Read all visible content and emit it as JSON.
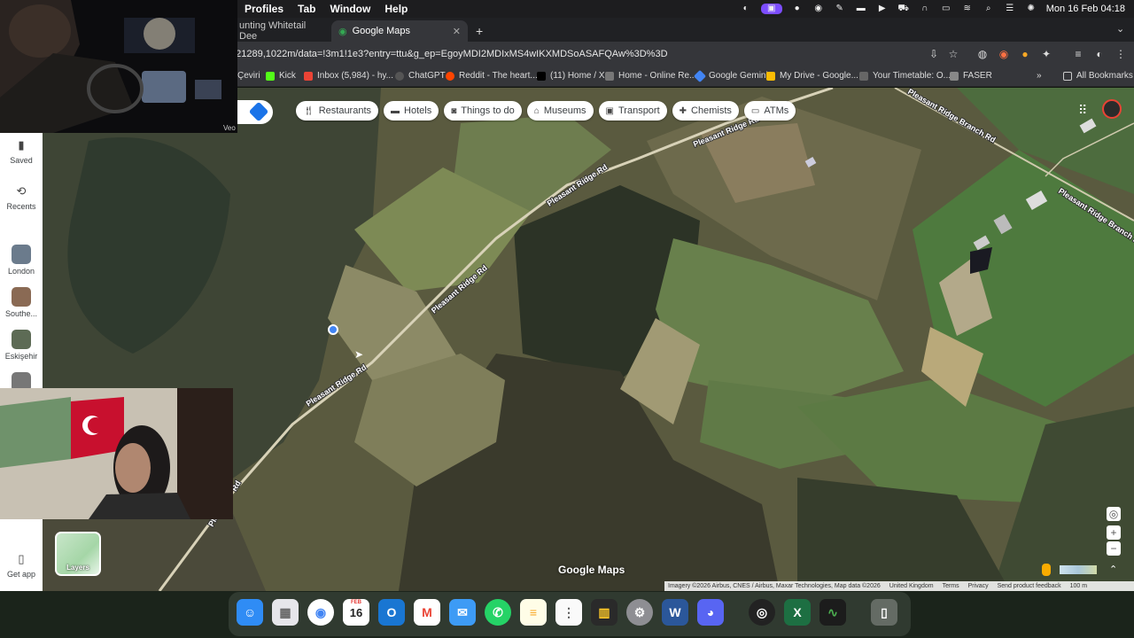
{
  "menubar": {
    "menus": [
      "Profiles",
      "Tab",
      "Window",
      "Help"
    ],
    "datetime": "Mon 16 Feb  04:18"
  },
  "tabs": [
    {
      "title": "unting Whitetail Dee",
      "active": false
    },
    {
      "title": "Google Maps",
      "active": true
    }
  ],
  "toolbar": {
    "url": "621289,1022m/data=!3m1!1e3?entry=ttu&g_ep=EgoyMDI2MDIxMS4wIKXMDSoASAFQAw%3D%3D"
  },
  "bookmarks": {
    "items": [
      "Çeviri",
      "Kick",
      "Inbox (5,984) - hy...",
      "ChatGPT",
      "Reddit - The heart...",
      "(11) Home / X",
      "Home - Online Re...",
      "Google Gemini",
      "My Drive - Google...",
      "Your Timetable: O...",
      "FASER"
    ],
    "all_bookmarks": "All Bookmarks"
  },
  "categories": [
    "Restaurants",
    "Hotels",
    "Things to do",
    "Museums",
    "Transport",
    "Chemists",
    "ATMs"
  ],
  "rail": {
    "saved": "Saved",
    "recents": "Recents",
    "places": [
      "London",
      "Southe...",
      "Eskişehir"
    ],
    "get_app": "Get app"
  },
  "map": {
    "road_labels": [
      "Pleasant Ridge Rd",
      "Pleasant Ridge Rd",
      "Pleasant Ridge Rd",
      "Pleasant Ridge Rd",
      "Pleasant Ridge Branch Rd",
      "Pleasant Ridge Branch Rd",
      "Ple",
      "Rd"
    ],
    "layers_label": "Layers",
    "logo": "Google Maps",
    "attribution": [
      "Imagery ©2026 Airbus, CNES / Airbus, Maxar Technologies, Map data ©2026",
      "United Kingdom",
      "Terms",
      "Privacy",
      "Send product feedback",
      "100 m"
    ]
  },
  "webcam": {
    "label": "Veo"
  },
  "dock": {
    "calendar_month": "FEB",
    "calendar_day": "16"
  }
}
